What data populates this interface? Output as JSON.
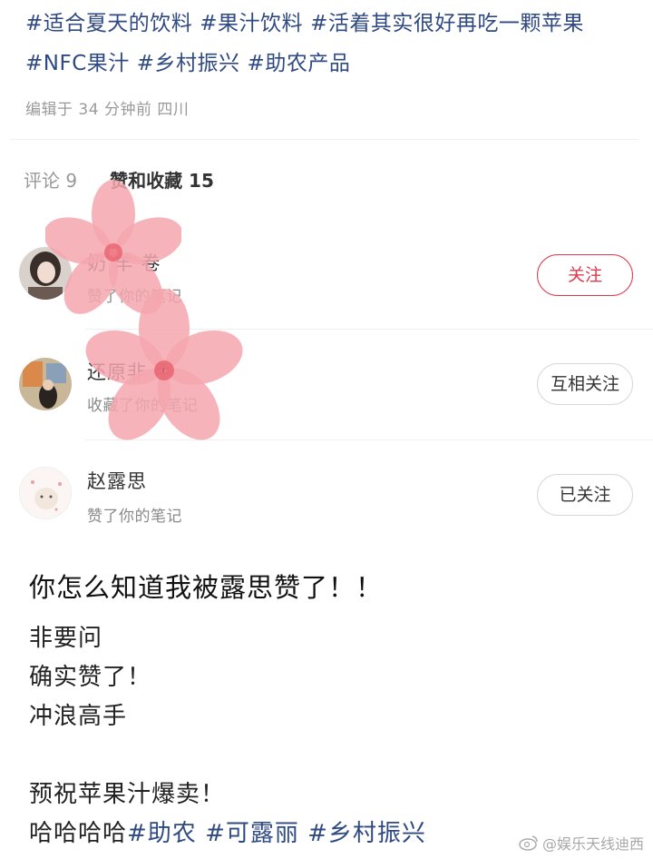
{
  "hashtags": [
    "#适合夏天的饮料",
    "#果汁饮料",
    "#活着其实很好再吃一颗苹果",
    "#NFC果汁",
    "#乡村振兴",
    "#助农产品"
  ],
  "edited_meta": "编辑于 34 分钟前 四川",
  "tabs": [
    {
      "label": "评论 9"
    },
    {
      "label": "赞和收藏 15"
    }
  ],
  "notifications": [
    {
      "name": "奶 羊 卷",
      "action": "赞了你的笔记",
      "button": "关注"
    },
    {
      "name": "还原非 手",
      "action": "收藏了你的笔记",
      "button": "互相关注"
    },
    {
      "name": "赵露思",
      "action": "赞了你的笔记",
      "button": "已关注"
    }
  ],
  "post": {
    "title": "你怎么知道我被露思赞了！！",
    "lines": [
      "非要问",
      "确实赞了！",
      "冲浪高手",
      "",
      "预祝苹果汁爆卖！"
    ],
    "last_line_prefix": "哈哈哈哈",
    "last_line_tags": [
      "#助农",
      "#可露丽",
      "#乡村振兴"
    ]
  },
  "watermark": "@娱乐天线迪西",
  "colors": {
    "tag": "#2f4a82",
    "follow": "#e0394f",
    "sticker": "#f4a6ae"
  },
  "icons": {
    "watermark": "weibo-icon",
    "sticker": "pink-flower-sticker"
  }
}
